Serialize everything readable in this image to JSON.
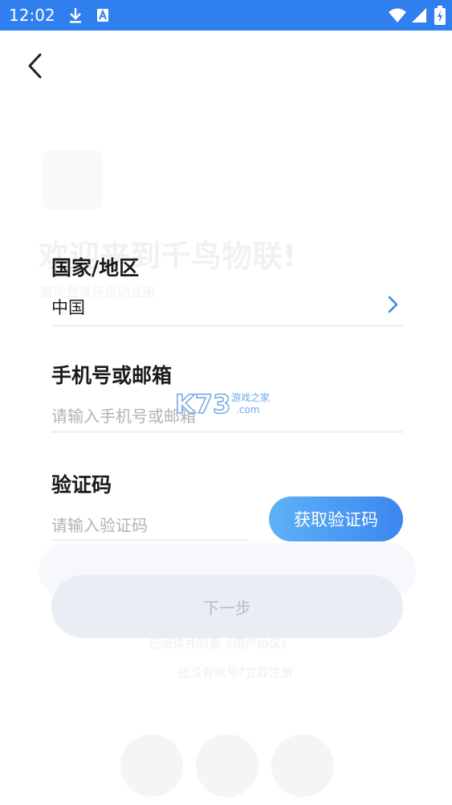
{
  "status_bar": {
    "time": "12:02",
    "icons": [
      "download-icon",
      "a-notification-icon",
      "wifi-icon",
      "cell-signal-icon",
      "battery-icon"
    ],
    "color": "#2f7fee"
  },
  "nav": {
    "back_icon": "chevron-left-icon"
  },
  "background_ghost": {
    "title": "欢迎来到千鸟物联!",
    "subtitle": "首次登录将自动注册",
    "link_text": "已阅读并同意《用户协议》",
    "line_text": "还没有账号?立即注册"
  },
  "form": {
    "country": {
      "label": "国家/地区",
      "value": "中国",
      "chevron_icon": "chevron-right-icon"
    },
    "account": {
      "label": "手机号或邮箱",
      "placeholder": "请输入手机号或邮箱"
    },
    "code": {
      "label": "验证码",
      "placeholder": "请输入验证码",
      "get_code_label": "获取验证码"
    },
    "next_label": "下一步"
  },
  "watermark": {
    "logo_text": "K73",
    "line1": "游戏之家",
    "line2": ".com"
  },
  "colors": {
    "accent": "#3b86ef",
    "accent_light": "#5fb2f7",
    "disabled_button": "#e9edf4",
    "divider": "#eef2f9"
  }
}
